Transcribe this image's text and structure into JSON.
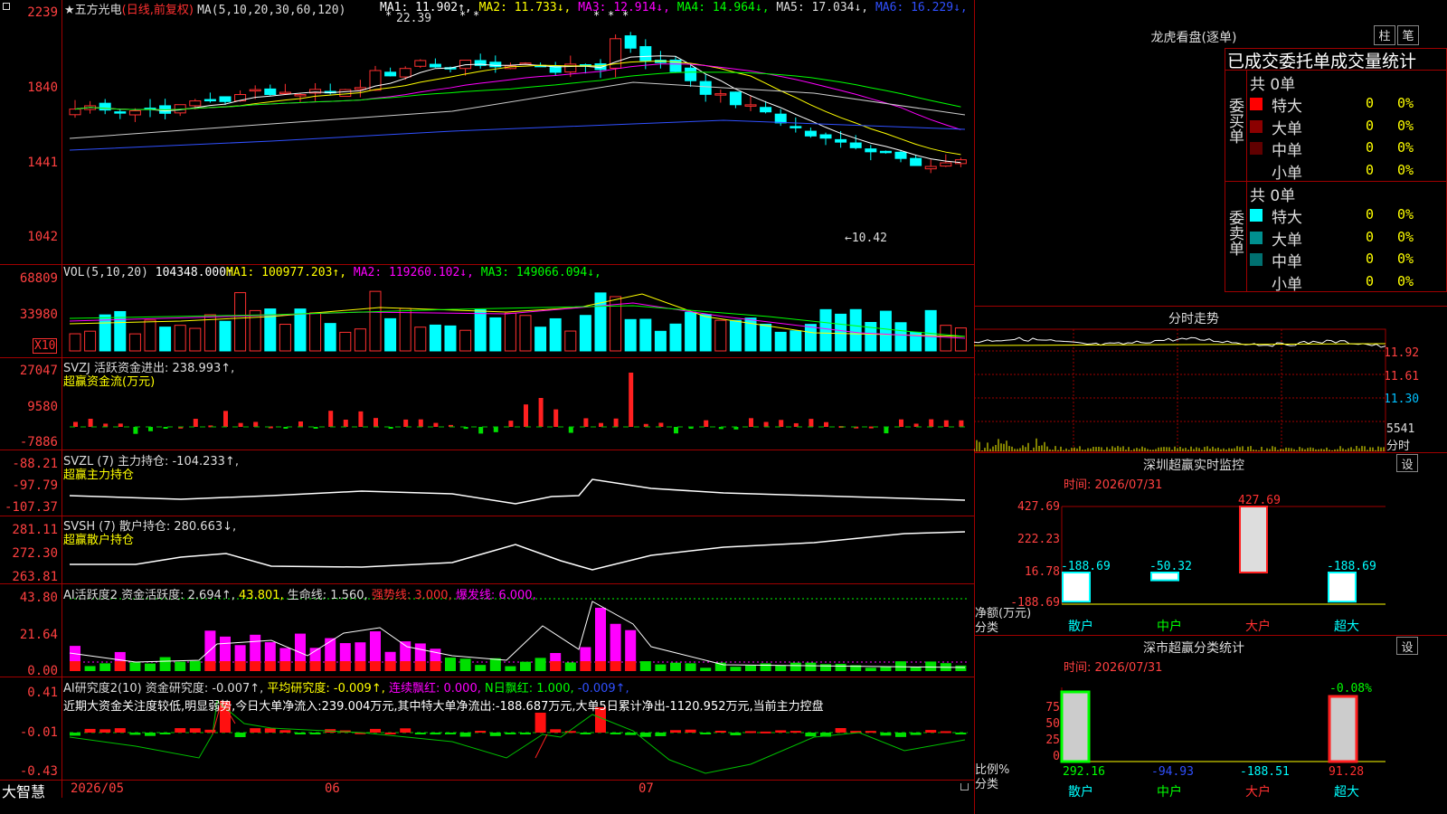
{
  "stock": {
    "star": "★",
    "name": "五方光电",
    "period": "(日线,前复权)"
  },
  "k_panel": {
    "ma_params": "MA(5,10,20,30,60,120)",
    "ma": [
      {
        "label": "MA1:",
        "value": "11.902↑",
        "color": "#ffffff"
      },
      {
        "label": "MA2:",
        "value": "11.733↓",
        "color": "#ffff00"
      },
      {
        "label": "MA3:",
        "value": "12.914↓",
        "color": "#ff00ff"
      },
      {
        "label": "MA4:",
        "value": "14.964↓",
        "color": "#00ff00"
      },
      {
        "label": "MA5:",
        "value": "17.034↓",
        "color": "#dddddd"
      },
      {
        "label": "MA6:",
        "value": "16.229↓",
        "color": "#3050ff"
      }
    ],
    "y_ticks": [
      "2239",
      "1840",
      "1441",
      "1042"
    ],
    "high_note": "22.39",
    "low_note": "←10.42"
  },
  "vol_panel": {
    "header": "VOL(5,10,20)",
    "value": "104348.000↑",
    "ma": [
      {
        "label": "MA1:",
        "value": "100977.203↑",
        "color": "#ffff00"
      },
      {
        "label": "MA2:",
        "value": "119260.102↓",
        "color": "#ff00ff"
      },
      {
        "label": "MA3:",
        "value": "149066.094↓",
        "color": "#00ff00"
      }
    ],
    "y_ticks": [
      "68809",
      "33980"
    ],
    "unit": "X10"
  },
  "svzj": {
    "header": "SVZJ  活跃资金进出: 238.993↑,",
    "sub": "超赢资金流(万元)",
    "y_ticks": [
      "27047",
      "9580",
      "-7886"
    ]
  },
  "svzl": {
    "header": "SVZL (7) 主力持仓: -104.233↑,",
    "sub": "超赢主力持仓",
    "y_ticks": [
      "-88.21",
      "-97.79",
      "-107.37"
    ]
  },
  "svsh": {
    "header": "SVSH (7) 散户持仓: 280.663↓,",
    "sub": "超赢散户持仓",
    "y_ticks": [
      "281.11",
      "272.30",
      "263.81"
    ]
  },
  "ai_active": {
    "header": "AI活跃度2 资金活跃度: 2.694↑,",
    "v2": "43.801,",
    "v3": "生命线: 1.560,",
    "v4": "强势线: 3.000,",
    "v5": "爆发线: 6.000,",
    "y_ticks": [
      "43.80",
      "21.64",
      "0.00"
    ]
  },
  "ai_research": {
    "header": "AI研究度2(10) 资金研究度: -0.007↑,",
    "p2": "平均研究度: -0.009↑,",
    "p3": "连续飘红: 0.000,",
    "p4": "N日飘红: 1.000,",
    "p5": "-0.009↑,",
    "note": "近期大资金关注度较低,明显弱势,今日大单净流入:239.004万元,其中特大单净流出:-188.687万元,大单5日累计净出-1120.952万元,当前主力控盘",
    "y_ticks": [
      "0.41",
      "-0.01",
      "-0.43"
    ]
  },
  "date_axis": {
    "brand": "大智慧",
    "labels": [
      "2026/05",
      "06",
      "07"
    ]
  },
  "right": {
    "lhb_title": "龙虎看盘(逐单)",
    "btn1": "柱",
    "btn2": "笔",
    "tabs": "已成交委托单成交量统计",
    "buy_side": "委买单",
    "sell_side": "委卖单",
    "buy_total": "共 0单",
    "sell_total": "共 0单",
    "buy_rows": [
      {
        "label": "特大",
        "n": "0",
        "pct": "0%",
        "color": "#ff0000"
      },
      {
        "label": "大单",
        "n": "0",
        "pct": "0%",
        "color": "#8b0000"
      },
      {
        "label": "中单",
        "n": "0",
        "pct": "0%",
        "color": "#600000"
      },
      {
        "label": "小单",
        "n": "0",
        "pct": "0%",
        "color": "#000000"
      }
    ],
    "sell_rows": [
      {
        "label": "特大",
        "n": "0",
        "pct": "0%",
        "color": "#00ffff"
      },
      {
        "label": "大单",
        "n": "0",
        "pct": "0%",
        "color": "#009090"
      },
      {
        "label": "中单",
        "n": "0",
        "pct": "0%",
        "color": "#007070"
      },
      {
        "label": "小单",
        "n": "0",
        "pct": "0%",
        "color": "#000000"
      }
    ],
    "intraday_title": "分时走势",
    "intraday_ticks": [
      "11.92",
      "11.61",
      "11.30"
    ],
    "intraday_vol": "5541",
    "intraday_vol_label": "分时",
    "monitor_title": "深圳超赢实时监控",
    "monitor_btn": "设",
    "monitor_time": "时间: 2026/07/31",
    "monitor_ticks": [
      "427.69",
      "222.23",
      "16.78",
      "-188.69"
    ],
    "monitor_unit": "净额(万元)",
    "monitor_axis": "分类",
    "monitor_values": [
      {
        "cat": "散户",
        "value": -188.69,
        "label": "-188.69"
      },
      {
        "cat": "中户",
        "value": -50.32,
        "label": "-50.32"
      },
      {
        "cat": "大户",
        "value": 427.69,
        "label": "427.69"
      },
      {
        "cat": "超大",
        "value": -188.69,
        "label": "-188.69"
      }
    ],
    "class_title": "深市超赢分类统计",
    "class_btn": "设",
    "class_time": "时间: 2026/07/31",
    "class_ticks": [
      "75",
      "50",
      "25",
      "0"
    ],
    "class_unit": "比例%",
    "class_axis": "分类",
    "class_top": "-0.08%",
    "class_values": [
      {
        "cat": "散户",
        "label": "292.16"
      },
      {
        "cat": "中户",
        "label": "-94.93"
      },
      {
        "cat": "大户",
        "label": "-188.51"
      },
      {
        "cat": "超大",
        "label": "91.28"
      }
    ]
  }
}
